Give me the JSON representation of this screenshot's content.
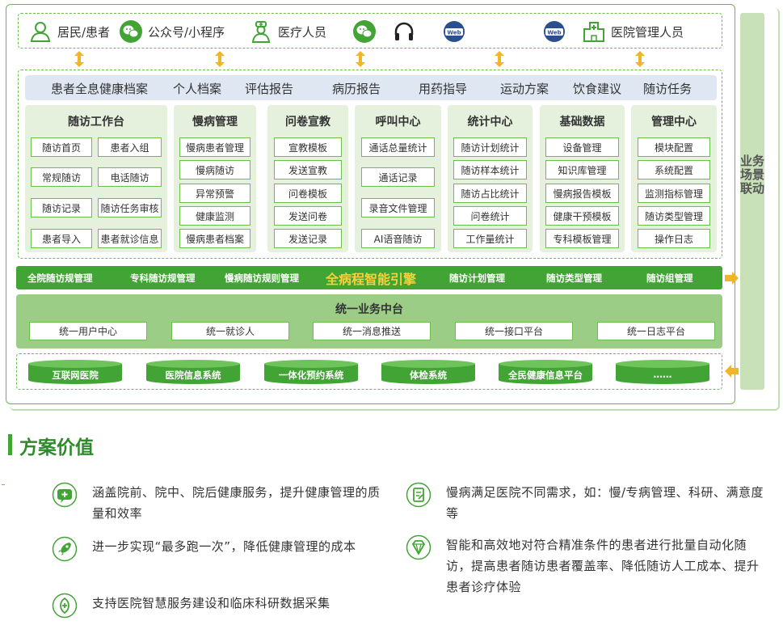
{
  "top_roles": [
    {
      "icon": "person-icon",
      "label": "居民/患者"
    },
    {
      "icon": "wechat-icon",
      "label": "公众号/小程序"
    },
    {
      "icon": "doctor-icon",
      "label": "医疗人员"
    },
    {
      "icon": "wechat-icon",
      "label": ""
    },
    {
      "icon": "headset-icon",
      "label": ""
    },
    {
      "icon": "web-icon",
      "label": "Web"
    },
    {
      "icon": "web-icon",
      "label": "Web"
    },
    {
      "icon": "hospital-icon",
      "label": "医院管理人员"
    }
  ],
  "band_items": [
    "患者全息健康档案",
    "个人档案",
    "评估报告",
    "病历报告",
    "用药指导",
    "运动方案",
    "饮食建议",
    "随访任务"
  ],
  "modules": [
    {
      "title": "随访工作台",
      "items": [
        "随访首页",
        "患者入组",
        "常规随访",
        "电话随访",
        "随访记录",
        "随访任务审核",
        "患者导入",
        "患者就诊信息"
      ]
    },
    {
      "title": "慢病管理",
      "items": [
        "慢病患者管理",
        "慢病随访",
        "异常预警",
        "健康监测",
        "慢病患者档案"
      ]
    },
    {
      "title": "问卷宣教",
      "items": [
        "宣教模板",
        "发送宣教",
        "问卷模板",
        "发送问卷",
        "发送记录"
      ]
    },
    {
      "title": "呼叫中心",
      "items": [
        "通话总量统计",
        "通话记录",
        "录音文件管理",
        "AI语音随访"
      ]
    },
    {
      "title": "统计中心",
      "items": [
        "随访计划统计",
        "随访样本统计",
        "随访占比统计",
        "问卷统计",
        "工作量统计"
      ]
    },
    {
      "title": "基础数据",
      "items": [
        "设备管理",
        "知识库管理",
        "慢病报告模板",
        "健康干预模板",
        "专科模板管理"
      ]
    },
    {
      "title": "管理中心",
      "items": [
        "模块配置",
        "系统配置",
        "监测指标管理",
        "随访类型管理",
        "操作日志"
      ]
    }
  ],
  "engine": {
    "items": [
      "全院随访规管理",
      "专科随访规管理",
      "慢病随访规则管理",
      "全病程智能引擎",
      "随访计划管理",
      "随访类型管理",
      "随访组管理"
    ]
  },
  "center": {
    "title": "统一业务中台",
    "items": [
      "统一用户中心",
      "统一就诊人",
      "统一消息推送",
      "统一接口平台",
      "统一日志平台"
    ]
  },
  "systems": [
    "互联网医院",
    "医院信息系统",
    "一体化预约系统",
    "体检系统",
    "全民健康信息平台",
    "……"
  ],
  "sidebar_label": "业务场景联动",
  "section_title": "方案价值",
  "values": [
    {
      "icon": "plus-chat-icon",
      "text": "涵盖院前、院中、院后健康服务，提升健康管理的质量和效率"
    },
    {
      "icon": "document-icon",
      "text": "慢病满足医院不同需求，如：慢/专病管理、科研、满意度等"
    },
    {
      "icon": "rocket-icon",
      "text": "进一步实现“最多跑一次”，降低健康管理的成本"
    },
    {
      "icon": "diamond-icon",
      "text": "智能和高效地对符合精准条件的患者进行批量自动化随访，提高患者随访患者覆盖率、降低随访人工成本、提升患者诊疗体验"
    },
    {
      "icon": "plus-shield-icon",
      "text": "支持医院智慧服务建设和临床科研数据采集"
    }
  ],
  "colors": {
    "green": "#43a436",
    "light_green": "#e5f1dd",
    "blue_band": "#dfe7f3",
    "engine_text": "#f5d23b",
    "arrow": "#f0b62a"
  }
}
